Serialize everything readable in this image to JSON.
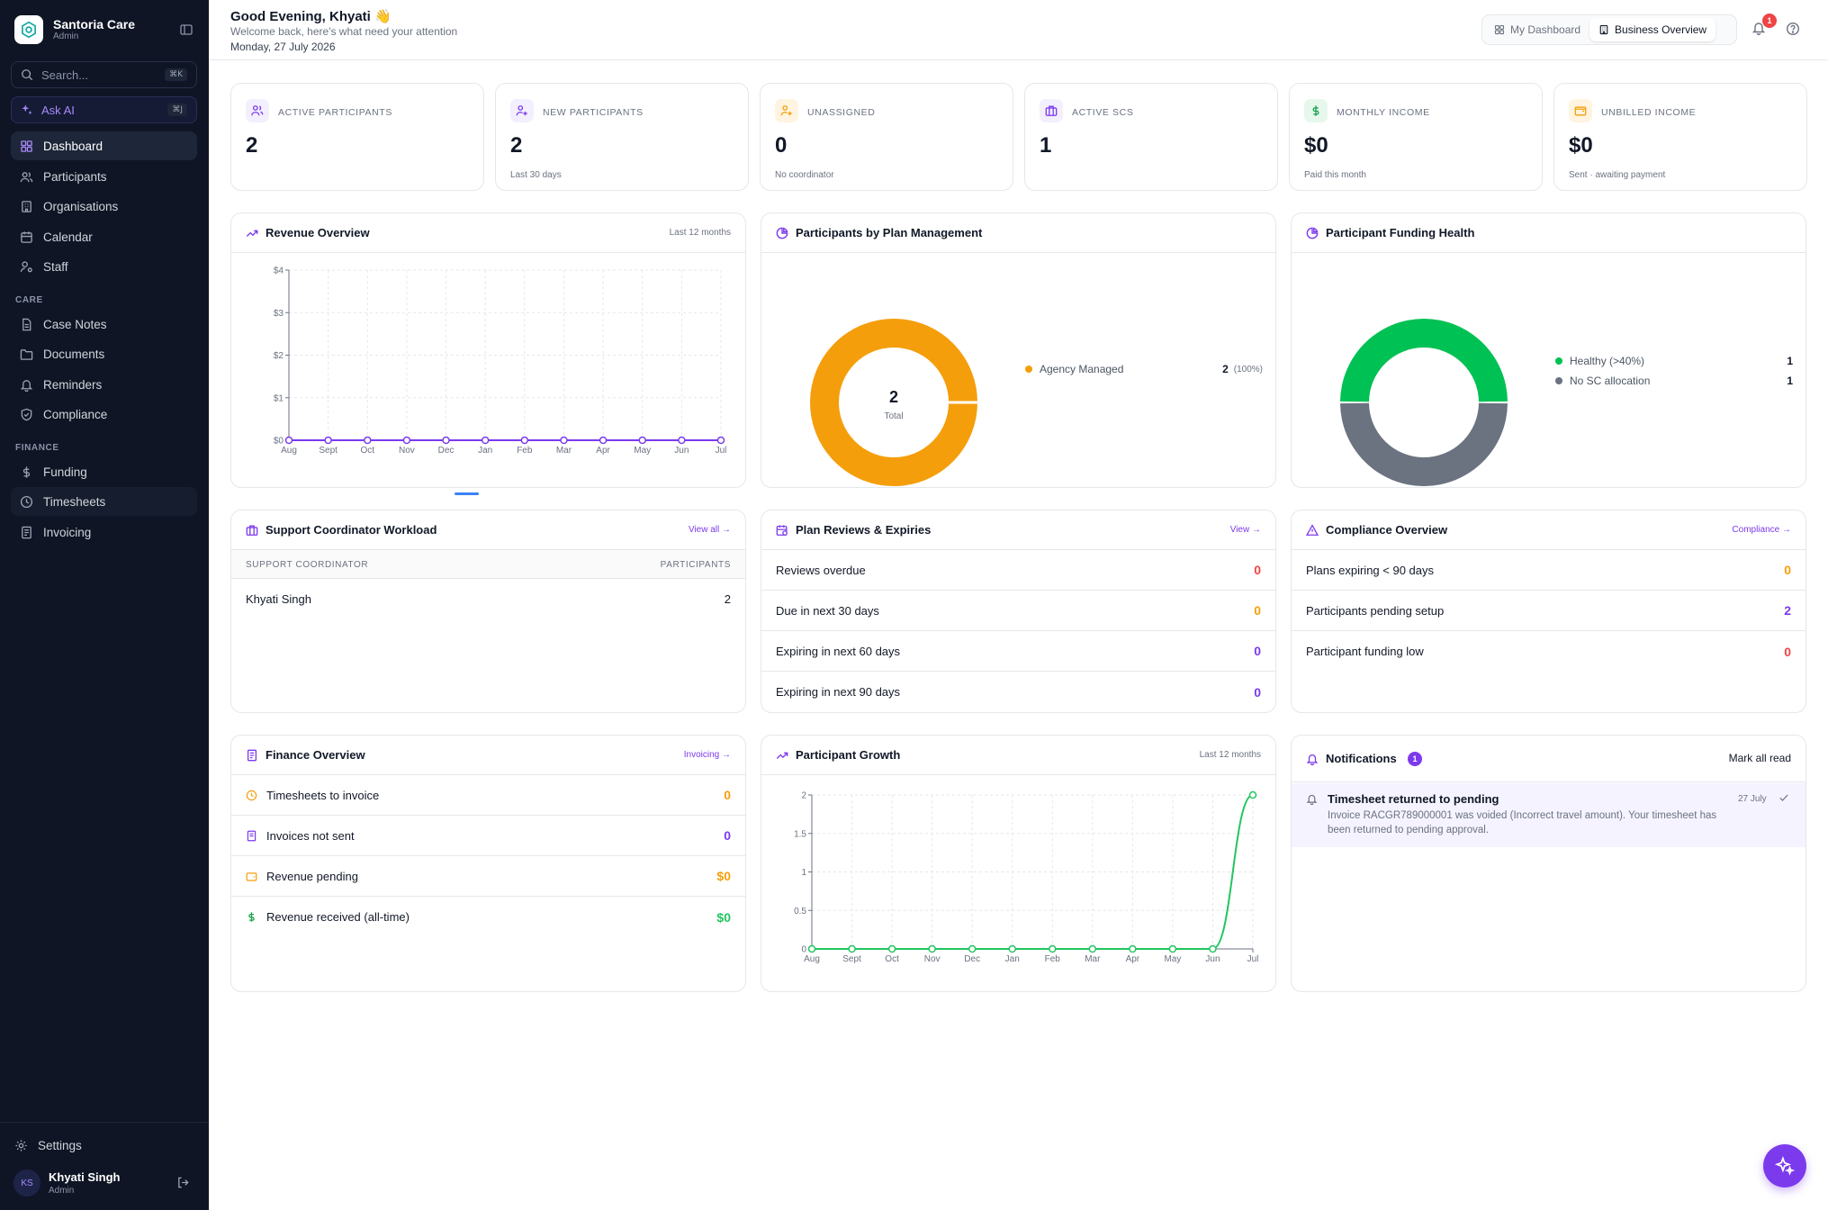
{
  "sidebar": {
    "brand_name": "Santoria Care",
    "brand_role": "Admin",
    "search_placeholder": "Search...",
    "search_shortcut": "⌘K",
    "ask_ai_label": "Ask AI",
    "ask_ai_shortcut": "⌘J",
    "main_items": [
      {
        "label": "Dashboard",
        "icon": "grid-icon"
      },
      {
        "label": "Participants",
        "icon": "users-icon"
      },
      {
        "label": "Organisations",
        "icon": "building-icon"
      },
      {
        "label": "Calendar",
        "icon": "calendar-icon"
      },
      {
        "label": "Staff",
        "icon": "user-cog-icon"
      }
    ],
    "care_label": "CARE",
    "care_items": [
      {
        "label": "Case Notes",
        "icon": "file-icon"
      },
      {
        "label": "Documents",
        "icon": "folder-icon"
      },
      {
        "label": "Reminders",
        "icon": "bell-icon"
      },
      {
        "label": "Compliance",
        "icon": "shield-icon"
      }
    ],
    "finance_label": "FINANCE",
    "finance_items": [
      {
        "label": "Funding",
        "icon": "dollar-icon"
      },
      {
        "label": "Timesheets",
        "icon": "clock-icon"
      },
      {
        "label": "Invoicing",
        "icon": "receipt-icon"
      }
    ],
    "settings_label": "Settings",
    "user_initials": "KS",
    "user_name": "Khyati Singh",
    "user_role": "Admin"
  },
  "header": {
    "greeting": "Good Evening, Khyati 👋",
    "subtitle": "Welcome back, here's what need your attention",
    "date": "Monday, 27 July 2026",
    "tab_my_dashboard": "My Dashboard",
    "tab_business_overview": "Business Overview",
    "notification_count": "1"
  },
  "stats": [
    {
      "label": "ACTIVE PARTICIPANTS",
      "value": "2",
      "sub": "",
      "icon": "users-icon",
      "color": "#7c3aed"
    },
    {
      "label": "NEW PARTICIPANTS",
      "value": "2",
      "sub": "Last 30 days",
      "icon": "user-plus-icon",
      "color": "#7c3aed"
    },
    {
      "label": "UNASSIGNED",
      "value": "0",
      "sub": "No coordinator",
      "icon": "user-plus-icon",
      "color": "#f59e0b"
    },
    {
      "label": "ACTIVE SCS",
      "value": "1",
      "sub": "",
      "icon": "briefcase-icon",
      "color": "#7c3aed"
    },
    {
      "label": "MONTHLY INCOME",
      "value": "$0",
      "sub": "Paid this month",
      "icon": "dollar-icon",
      "color": "#16a34a"
    },
    {
      "label": "UNBILLED INCOME",
      "value": "$0",
      "sub": "Sent · awaiting payment",
      "icon": "wallet-icon",
      "color": "#f59e0b"
    }
  ],
  "revenue": {
    "title": "Revenue Overview",
    "meta": "Last 12 months"
  },
  "plan_mgmt": {
    "title": "Participants by Plan Management",
    "center_value": "2",
    "center_label": "Total",
    "legend": [
      {
        "label": "Agency Managed",
        "value": "2",
        "pct": "(100%)",
        "color": "#f59e0b"
      }
    ]
  },
  "funding_health": {
    "title": "Participant Funding Health",
    "legend": [
      {
        "label": "Healthy (>40%)",
        "value": "1",
        "color": "#00c153"
      },
      {
        "label": "No SC allocation",
        "value": "1",
        "color": "#6b7280"
      }
    ]
  },
  "workload": {
    "title": "Support Coordinator Workload",
    "link": "View all →",
    "col_coordinator": "SUPPORT COORDINATOR",
    "col_participants": "PARTICIPANTS",
    "rows": [
      {
        "name": "Khyati Singh",
        "count": "2"
      }
    ]
  },
  "plan_reviews": {
    "title": "Plan Reviews & Expiries",
    "link": "View →",
    "rows": [
      {
        "label": "Reviews overdue",
        "value": "0"
      },
      {
        "label": "Due in next 30 days",
        "value": "0"
      },
      {
        "label": "Expiring in next 60 days",
        "value": "0"
      },
      {
        "label": "Expiring in next 90 days",
        "value": "0"
      }
    ]
  },
  "compliance": {
    "title": "Compliance Overview",
    "link": "Compliance →",
    "rows": [
      {
        "label": "Plans expiring < 90 days",
        "value": "0"
      },
      {
        "label": "Participants pending setup",
        "value": "2"
      },
      {
        "label": "Participant funding low",
        "value": "0"
      }
    ]
  },
  "finance": {
    "title": "Finance Overview",
    "link": "Invoicing →",
    "rows": [
      {
        "label": "Timesheets to invoice",
        "value": "0"
      },
      {
        "label": "Invoices not sent",
        "value": "0"
      },
      {
        "label": "Revenue pending",
        "value": "$0"
      },
      {
        "label": "Revenue received (all-time)",
        "value": "$0"
      }
    ]
  },
  "growth": {
    "title": "Participant Growth",
    "meta": "Last 12 months"
  },
  "notifications": {
    "title": "Notifications",
    "count": "1",
    "mark_all": "Mark all read",
    "items": [
      {
        "title": "Timesheet returned to pending",
        "date": "27 July",
        "body_line1": "Invoice RACGR789000001 was voided (Incorrect travel amount). Your timesheet has",
        "body_line2": "been returned to pending approval."
      }
    ]
  },
  "chart_data": [
    {
      "type": "line",
      "title": "Revenue Overview",
      "categories": [
        "Aug",
        "Sept",
        "Oct",
        "Nov",
        "Dec",
        "Jan",
        "Feb",
        "Mar",
        "Apr",
        "May",
        "Jun",
        "Jul"
      ],
      "series": [
        {
          "values": [
            0,
            0,
            0,
            0,
            0,
            0,
            0,
            0,
            0,
            0,
            0,
            0
          ],
          "color": "#7c3aed"
        }
      ],
      "yticks": [
        "$0",
        "$1",
        "$2",
        "$3",
        "$4"
      ],
      "ylim": [
        0,
        4
      ],
      "grid": true
    },
    {
      "type": "pie",
      "title": "Participants by Plan Management",
      "labels": [
        "Agency Managed"
      ],
      "values": [
        2
      ],
      "colors": [
        "#f59e0b"
      ]
    },
    {
      "type": "pie",
      "title": "Participant Funding Health",
      "labels": [
        "Healthy (>40%)",
        "No SC allocation"
      ],
      "values": [
        1,
        1
      ],
      "colors": [
        "#00c153",
        "#6b7280"
      ]
    },
    {
      "type": "line",
      "title": "Participant Growth",
      "categories": [
        "Aug",
        "Sept",
        "Oct",
        "Nov",
        "Dec",
        "Jan",
        "Feb",
        "Mar",
        "Apr",
        "May",
        "Jun",
        "Jul"
      ],
      "series": [
        {
          "values": [
            0,
            0,
            0,
            0,
            0,
            0,
            0,
            0,
            0,
            0,
            0,
            2
          ],
          "color": "#22c55e"
        }
      ],
      "yticks": [
        "0",
        "0.5",
        "1",
        "1.5",
        "2"
      ],
      "ylim": [
        0,
        2
      ],
      "grid": true
    }
  ]
}
